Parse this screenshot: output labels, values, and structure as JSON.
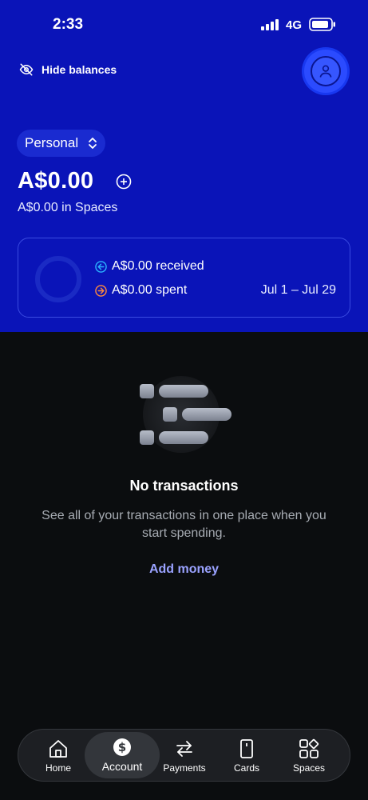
{
  "status_bar": {
    "time": "2:33",
    "network": "4G"
  },
  "header": {
    "hide_balances_label": "Hide balances"
  },
  "account": {
    "selector_label": "Personal",
    "balance": "A$0.00",
    "spaces_balance": "A$0.00 in Spaces"
  },
  "summary": {
    "received": "A$0.00 received",
    "spent": "A$0.00 spent",
    "period": "Jul 1 – Jul 29"
  },
  "empty_state": {
    "title": "No transactions",
    "description": "See all of your transactions in one place when you start spending.",
    "action": "Add money"
  },
  "tabs": [
    {
      "label": "Home",
      "icon": "home-icon"
    },
    {
      "label": "Account",
      "icon": "dollar-icon"
    },
    {
      "label": "Payments",
      "icon": "transfer-icon"
    },
    {
      "label": "Cards",
      "icon": "card-icon"
    },
    {
      "label": "Spaces",
      "icon": "spaces-icon"
    }
  ],
  "colors": {
    "header_bg": "#0a14b8",
    "page_bg": "#0b0d0f",
    "accent_link": "#9aa2ff",
    "received_icon": "#2bb3ff",
    "spent_icon": "#ff8a3d"
  }
}
